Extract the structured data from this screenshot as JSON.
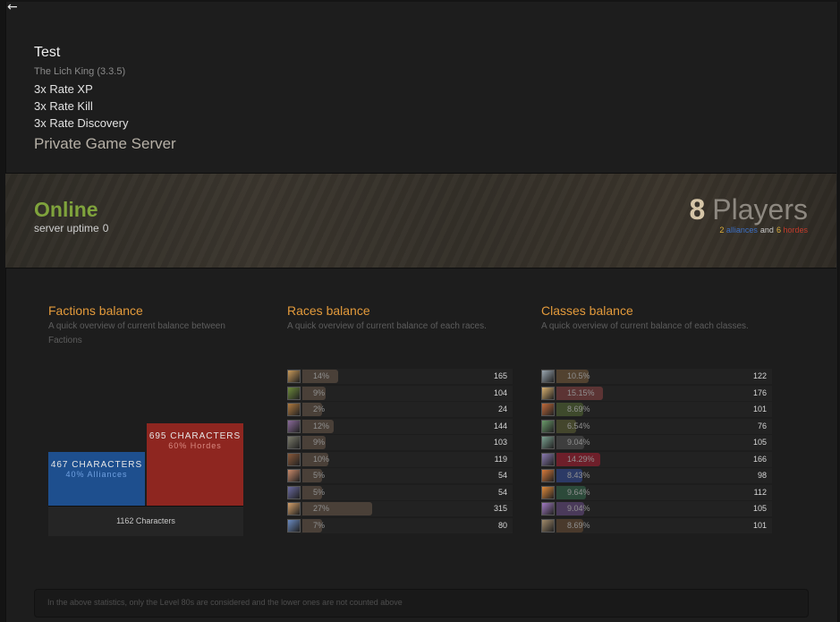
{
  "nav": {
    "back_icon": "left-arrow-icon",
    "back_glyph": "←"
  },
  "header": {
    "title": "Test",
    "version": "The Lich King (3.3.5)",
    "rates": [
      "3x Rate XP",
      "3x Rate Kill",
      "3x Rate Discovery"
    ],
    "subtitle": "Private Game Server"
  },
  "status": {
    "state": "Online",
    "uptime_label": "server uptime",
    "uptime_value": "0",
    "players_count": "8",
    "players_label": "Players",
    "alliances_count": "2",
    "alliances_label": "alliances",
    "and_label": "and",
    "hordes_count": "6",
    "hordes_label": "hordes"
  },
  "factions": {
    "title": "Factions balance",
    "desc": "A quick overview of current balance between Factions",
    "alliance_chars": "467 CHARACTERS",
    "alliance_pct_label": "40% Alliances",
    "horde_chars": "695 CHARACTERS",
    "horde_pct_label": "60% Hordes",
    "total_label": "1162 Characters",
    "alliance_fraction": 0.4,
    "horde_fraction": 0.6,
    "colors": {
      "alliance": "#1e4f8e",
      "horde": "#8e2620"
    }
  },
  "races": {
    "title": "Races balance",
    "desc": "A quick overview of current balance of each races.",
    "rows": [
      {
        "pct": "14%",
        "count": "165",
        "value": 14,
        "icon": "human-race-icon",
        "icolor": "#c99a5a",
        "bcolor": "#4a4038"
      },
      {
        "pct": "9%",
        "count": "104",
        "value": 9,
        "icon": "orc-race-icon",
        "icolor": "#6d8a3a",
        "bcolor": "#4a4038"
      },
      {
        "pct": "2%",
        "count": "24",
        "value": 2,
        "icon": "dwarf-race-icon",
        "icolor": "#b07a3f",
        "bcolor": "#4a4038"
      },
      {
        "pct": "12%",
        "count": "144",
        "value": 12,
        "icon": "night-elf-race-icon",
        "icolor": "#8a6a9a",
        "bcolor": "#4a4038"
      },
      {
        "pct": "9%",
        "count": "103",
        "value": 9,
        "icon": "undead-race-icon",
        "icolor": "#7a7a6a",
        "bcolor": "#4a4038"
      },
      {
        "pct": "10%",
        "count": "119",
        "value": 10,
        "icon": "tauren-race-icon",
        "icolor": "#8a5a3a",
        "bcolor": "#4a4038"
      },
      {
        "pct": "5%",
        "count": "54",
        "value": 5,
        "icon": "gnome-race-icon",
        "icolor": "#c98a6a",
        "bcolor": "#4a4038"
      },
      {
        "pct": "5%",
        "count": "54",
        "value": 5,
        "icon": "troll-race-icon",
        "icolor": "#6a6aa0",
        "bcolor": "#4a4038"
      },
      {
        "pct": "27%",
        "count": "315",
        "value": 27,
        "icon": "blood-elf-race-icon",
        "icolor": "#d4a06a",
        "bcolor": "#4a4038"
      },
      {
        "pct": "7%",
        "count": "80",
        "value": 7,
        "icon": "draenei-race-icon",
        "icolor": "#6a8ac0",
        "bcolor": "#4a4038"
      }
    ]
  },
  "classes": {
    "title": "Classes balance",
    "desc": "A quick overview of current balance of each classes.",
    "rows": [
      {
        "pct": "10.5%",
        "count": "122",
        "value": 10.5,
        "icon": "warrior-class-icon",
        "icolor": "#9aa6b0",
        "bcolor": "#524230"
      },
      {
        "pct": "15.15%",
        "count": "176",
        "value": 15.15,
        "icon": "paladin-class-icon",
        "icolor": "#d8b070",
        "bcolor": "#5c3434"
      },
      {
        "pct": "8.69%",
        "count": "101",
        "value": 8.69,
        "icon": "hunter-class-icon",
        "icolor": "#c06a3a",
        "bcolor": "#3e4a2c"
      },
      {
        "pct": "6.54%",
        "count": "76",
        "value": 6.54,
        "icon": "rogue-class-icon",
        "icolor": "#6a9a6a",
        "bcolor": "#44462c"
      },
      {
        "pct": "9.04%",
        "count": "105",
        "value": 9.04,
        "icon": "priest-class-icon",
        "icolor": "#7aa090",
        "bcolor": "#3e3e3e"
      },
      {
        "pct": "14.29%",
        "count": "166",
        "value": 14.29,
        "icon": "death-knight-class-icon",
        "icolor": "#8a7ab0",
        "bcolor": "#6e1f2a"
      },
      {
        "pct": "8.43%",
        "count": "98",
        "value": 8.43,
        "icon": "shaman-class-icon",
        "icolor": "#d87a3a",
        "bcolor": "#2c3a66"
      },
      {
        "pct": "9.64%",
        "count": "112",
        "value": 9.64,
        "icon": "mage-class-icon",
        "icolor": "#e08a3a",
        "bcolor": "#2c4a3a"
      },
      {
        "pct": "9.04%",
        "count": "105",
        "value": 9.04,
        "icon": "warlock-class-icon",
        "icolor": "#a07ac0",
        "bcolor": "#4a3a5a"
      },
      {
        "pct": "8.69%",
        "count": "101",
        "value": 8.69,
        "icon": "druid-class-icon",
        "icolor": "#a08a6a",
        "bcolor": "#4a3a2c"
      }
    ]
  },
  "footer": {
    "note": "In the above statistics, only the Level 80s are considered and the lower ones are not counted above"
  }
}
